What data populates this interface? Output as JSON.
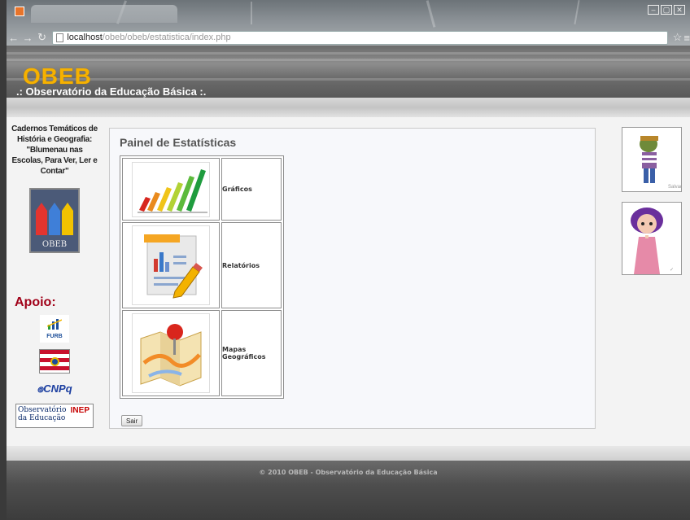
{
  "browser": {
    "url_host": "localhost",
    "url_path": "/obeb/obeb/estatistica/index.php",
    "window_controls": [
      "–",
      "▢",
      "✕"
    ]
  },
  "header": {
    "logo_text": "OBEB",
    "subtitle": ".: Observatório da Educação Básica :."
  },
  "sidebar_left": {
    "caption": "Cadernos Temáticos de História e Geografia: \"Blumenau nas Escolas, Para Ver, Ler e Contar\"",
    "cadernos_logo_label": "OBEB",
    "apoio_title": "Apoio:",
    "sponsors": {
      "furb": "FURB",
      "cnpq": "CNPq",
      "observatorio_line1": "Observatório",
      "observatorio_line2": "da Educação",
      "inep": "INEP"
    }
  },
  "panel": {
    "title": "Painel de Estatísticas",
    "items": [
      {
        "label": "Gráficos",
        "icon": "bar-chart-icon"
      },
      {
        "label": "Relatórios",
        "icon": "report-icon"
      },
      {
        "label": "Mapas Geográficos",
        "icon": "map-icon"
      }
    ],
    "logout_label": "Sair"
  },
  "footer": {
    "text": "© 2010 OBEB - Observatório da Educação Básica"
  },
  "colors": {
    "logo": "#f6b100",
    "apoio": "#a00018"
  }
}
